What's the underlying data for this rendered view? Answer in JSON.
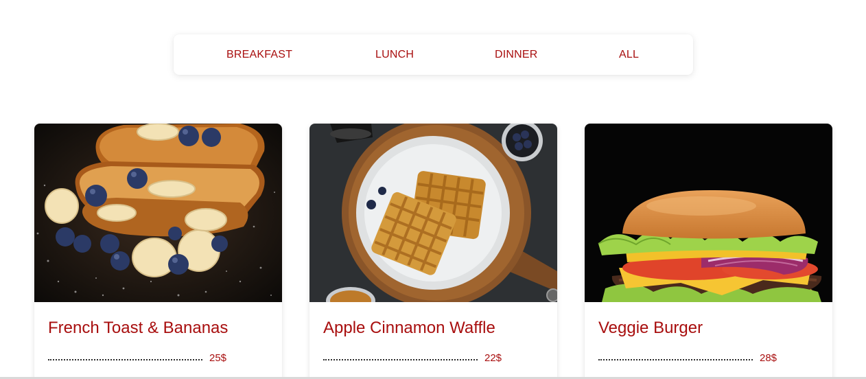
{
  "tabs": [
    {
      "label": "BREAKFAST"
    },
    {
      "label": "LUNCH"
    },
    {
      "label": "DINNER"
    },
    {
      "label": "ALL"
    }
  ],
  "menu_items": [
    {
      "title": "French Toast & Bananas",
      "price": "25$",
      "image": "french-toast-photo"
    },
    {
      "title": "Apple Cinnamon Waffle",
      "price": "22$",
      "image": "waffle-photo"
    },
    {
      "title": "Veggie Burger",
      "price": "28$",
      "image": "burger-photo"
    }
  ],
  "colors": {
    "accent": "#a80e0e",
    "background": "#ffffff"
  }
}
